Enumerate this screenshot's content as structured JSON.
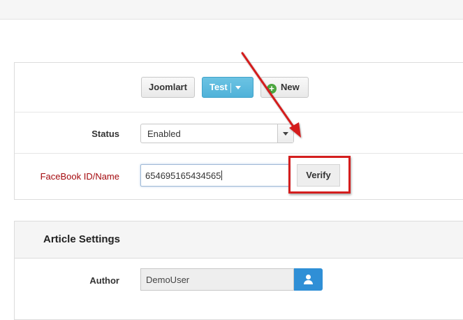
{
  "toolbar": {
    "buttons": {
      "joomlart": "Joomlart",
      "test": "Test",
      "new": "New"
    }
  },
  "form": {
    "status": {
      "label": "Status",
      "value": "Enabled"
    },
    "facebook": {
      "label": "FaceBook ID/Name",
      "value": "654695165434565",
      "verify_label": "Verify"
    }
  },
  "article_settings": {
    "title": "Article Settings",
    "author": {
      "label": "Author",
      "value": "DemoUser"
    }
  },
  "colors": {
    "accent_blue": "#4fb2d9",
    "annotation_red": "#d41e1e",
    "error_label": "#a4090d",
    "user_button": "#2f8fd6"
  },
  "icons": [
    "plus-icon",
    "caret-down-icon",
    "user-icon",
    "annotation-arrow"
  ]
}
